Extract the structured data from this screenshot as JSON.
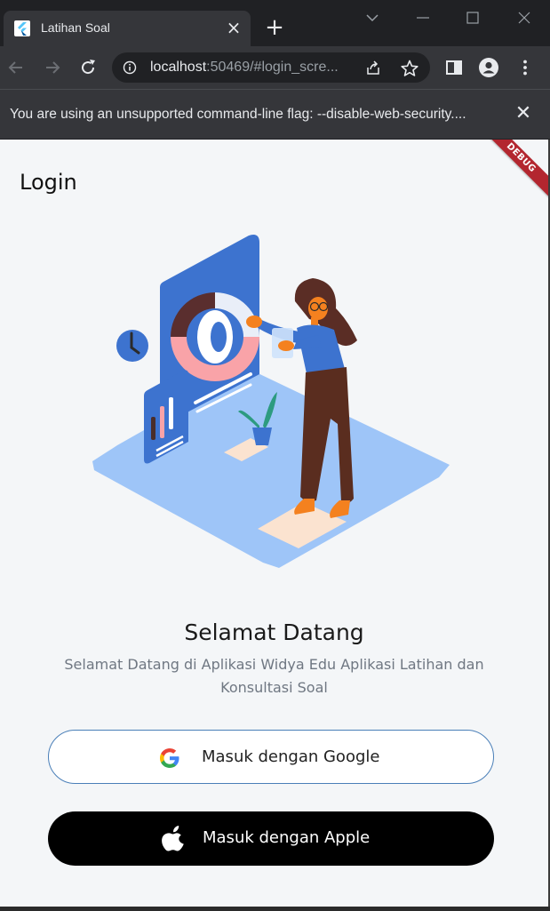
{
  "browser": {
    "tab_title": "Latihan Soal",
    "url_host": "localhost",
    "url_rest": ":50469/#login_scre...",
    "infobar_text": "You are using an unsupported command-line flag: --disable-web-security...."
  },
  "app": {
    "debug_banner": "DEBUG",
    "page_title": "Login",
    "welcome_title": "Selamat Datang",
    "welcome_subtitle": "Selamat Datang di Aplikasi Widya Edu Aplikasi Latihan dan Konsultasi Soal",
    "google_button_label": "Masuk dengan Google",
    "apple_button_label": "Masuk dengan Apple"
  },
  "colors": {
    "chrome_dark": "#202124",
    "chrome_tab": "#35363a",
    "app_background": "#f4f6f8",
    "illustration_blue": "#3d73cf",
    "debug_red": "#b3262f",
    "google_border": "#4a7fb8"
  },
  "icons": {
    "tab_favicon": "flutter-icon",
    "close": "close-icon",
    "new_tab": "plus-icon",
    "back": "arrow-left-icon",
    "forward": "arrow-right-icon",
    "reload": "reload-icon",
    "site_info": "info-icon",
    "share": "share-icon",
    "bookmark": "star-icon",
    "side_panel": "side-panel-icon",
    "profile": "profile-icon",
    "menu": "kebab-menu-icon",
    "google": "google-icon",
    "apple": "apple-icon"
  }
}
